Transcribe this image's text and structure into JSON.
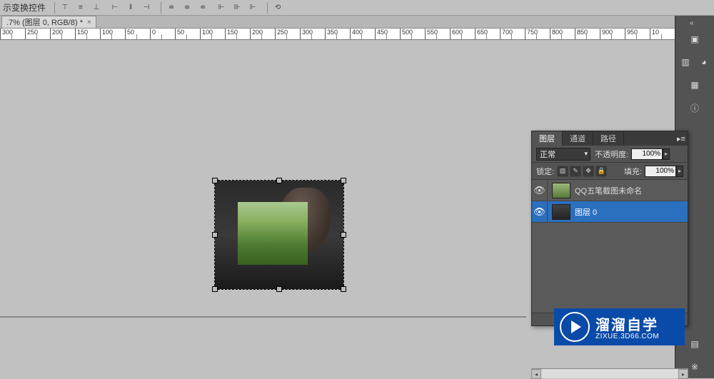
{
  "toolbar": {
    "label": "示变换控件"
  },
  "tab": {
    "title": ".7% (图层 0, RGB/8) *",
    "close": "×"
  },
  "ruler": {
    "ticks": [
      "300",
      "250",
      "200",
      "150",
      "100",
      "50",
      "0",
      "50",
      "100",
      "150",
      "200",
      "250",
      "300",
      "350",
      "400",
      "450",
      "500",
      "550",
      "600",
      "650",
      "700",
      "750",
      "800",
      "850",
      "900",
      "950",
      "10"
    ]
  },
  "panel": {
    "tabs": {
      "layers": "图层",
      "channels": "通道",
      "paths": "路径"
    },
    "blend_mode": "正常",
    "opacity_label": "不透明度:",
    "opacity_value": "100%",
    "lock_label": "锁定:",
    "fill_label": "填充:",
    "fill_value": "100%",
    "layers": [
      {
        "name": "QQ五笔截图未命名"
      },
      {
        "name": "图层 0"
      }
    ]
  },
  "watermark": {
    "cn": "溜溜自学",
    "url": "ZIXUE.3D66.COM"
  }
}
